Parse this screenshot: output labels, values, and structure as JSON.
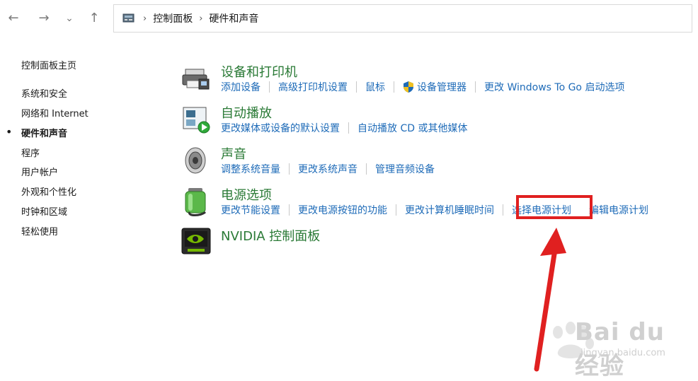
{
  "nav": {
    "back_icon": "←",
    "forward_icon": "→",
    "recent_icon": "⌄",
    "up_icon": "↑"
  },
  "address": {
    "sep": "›",
    "crumbs": [
      "控制面板",
      "硬件和声音"
    ]
  },
  "sidebar": {
    "home": "控制面板主页",
    "items": [
      {
        "label": "系统和安全"
      },
      {
        "label": "网络和 Internet"
      },
      {
        "label": "硬件和声音",
        "active": true
      },
      {
        "label": "程序"
      },
      {
        "label": "用户帐户"
      },
      {
        "label": "外观和个性化"
      },
      {
        "label": "时钟和区域"
      },
      {
        "label": "轻松使用"
      }
    ],
    "bullet": "•"
  },
  "categories": [
    {
      "title": "设备和打印机",
      "icon": "printer-icon",
      "links": [
        "添加设备",
        "高级打印机设置",
        "鼠标",
        "设备管理器",
        "更改 Windows To Go 启动选项"
      ]
    },
    {
      "title": "自动播放",
      "icon": "autoplay-icon",
      "links": [
        "更改媒体或设备的默认设置",
        "自动播放 CD 或其他媒体"
      ]
    },
    {
      "title": "声音",
      "icon": "speaker-icon",
      "links": [
        "调整系统音量",
        "更改系统声音",
        "管理音频设备"
      ]
    },
    {
      "title": "电源选项",
      "icon": "power-options-icon",
      "links": [
        "更改节能设置",
        "更改电源按钮的功能",
        "更改计算机睡眠时间",
        "选择电源计划",
        "编辑电源计划"
      ]
    },
    {
      "title": "NVIDIA 控制面板",
      "icon": "nvidia-icon",
      "links": []
    }
  ],
  "colors": {
    "category_title": "#2a7a36",
    "link": "#1e6bb8",
    "annotation": "#e02020"
  },
  "watermark": {
    "text": "Bai du 经验",
    "url": "jingyan.baidu.com"
  }
}
